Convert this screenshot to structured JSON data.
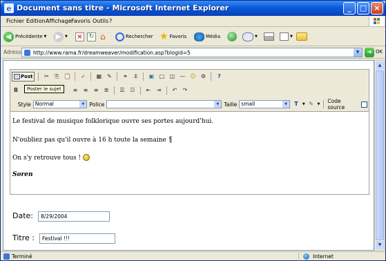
{
  "window": {
    "title": "Document sans titre - Microsoft Internet Explorer"
  },
  "menu": [
    "Fichier",
    "Edition",
    "Affichage",
    "Favoris",
    "Outils",
    "?"
  ],
  "toolbar": {
    "back_label": "Précédente",
    "search_label": "Rechercher",
    "favorites_label": "Favoris",
    "media_label": "Média"
  },
  "address": {
    "label": "Adresse",
    "url": "http://www.rama.fr/dreamweaver/modification.asp?blogid=5",
    "go_label": "OK"
  },
  "editor": {
    "post_label": "Post",
    "tooltip": "Poster le sujet",
    "style_label": "Style",
    "style_value": "Normal",
    "font_label": "Police",
    "font_value": "",
    "size_label": "Taille",
    "size_value": "small",
    "source_label": "Code source",
    "lines": [
      "Le festival de musique folklorique ouvre ses portes aujourd'hui.",
      "N'oubliez pas qu'il ouvre à 16 h toute la semaine !",
      "On s'y retrouve tous !",
      "Soren"
    ]
  },
  "form": {
    "date_label": "Date:",
    "date_value": "8/29/2004",
    "title_label": "Titre :",
    "title_value": "Festival !!!"
  },
  "status": {
    "text": "Terminé",
    "zone": "Internet"
  },
  "colors": {
    "titlebar": "#0b5ad9",
    "chrome": "#ece9d8",
    "input_border": "#7f9db9"
  }
}
